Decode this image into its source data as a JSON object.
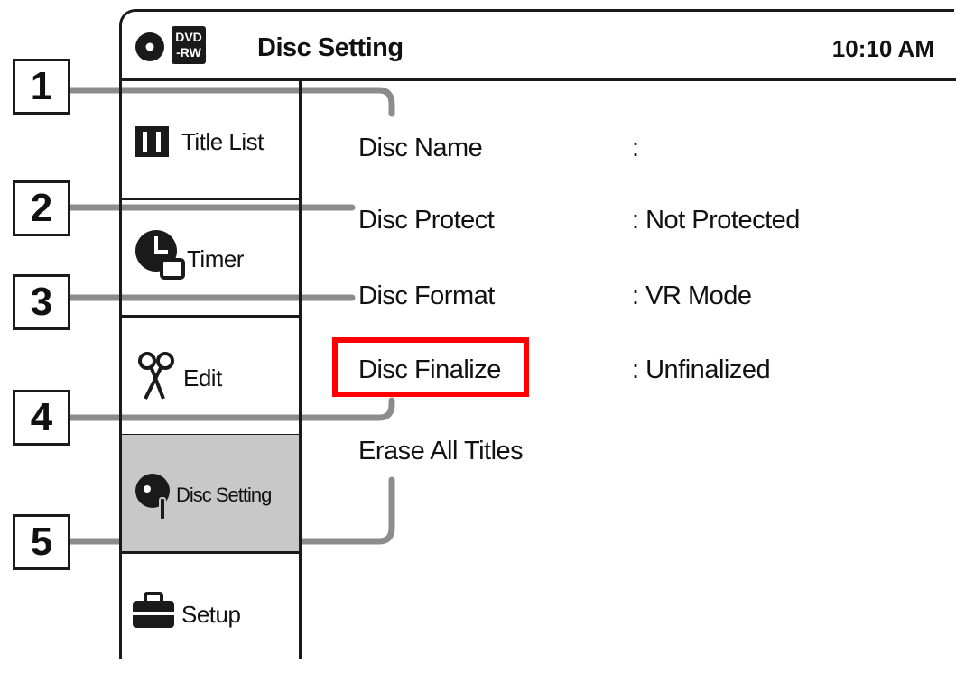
{
  "header": {
    "badge_top": "DVD",
    "badge_bottom": "-RW",
    "title": "Disc Setting",
    "clock": "10:10 AM"
  },
  "sidebar": {
    "items": [
      {
        "label": "Title List",
        "icon": "title-list-icon",
        "active": false
      },
      {
        "label": "Timer",
        "icon": "timer-icon",
        "active": false
      },
      {
        "label": "Edit",
        "icon": "scissors-icon",
        "active": false
      },
      {
        "label": "Disc Setting",
        "icon": "disc-setting-icon",
        "active": true
      },
      {
        "label": "Setup",
        "icon": "toolbox-icon",
        "active": false
      }
    ]
  },
  "settings": [
    {
      "label": "Disc Name",
      "value": ":"
    },
    {
      "label": "Disc Protect",
      "value": ":  Not Protected"
    },
    {
      "label": "Disc Format",
      "value": ":  VR Mode"
    },
    {
      "label": "Disc Finalize",
      "value": ":  Unfinalized",
      "highlighted": true
    },
    {
      "label": "Erase All Titles",
      "value": ""
    }
  ],
  "callouts": [
    "1",
    "2",
    "3",
    "4",
    "5"
  ],
  "colors": {
    "highlight": "#ff0000",
    "active_item": "#c8c8c8",
    "line": "#1a1a1a",
    "leader": "#8c8c8c"
  }
}
